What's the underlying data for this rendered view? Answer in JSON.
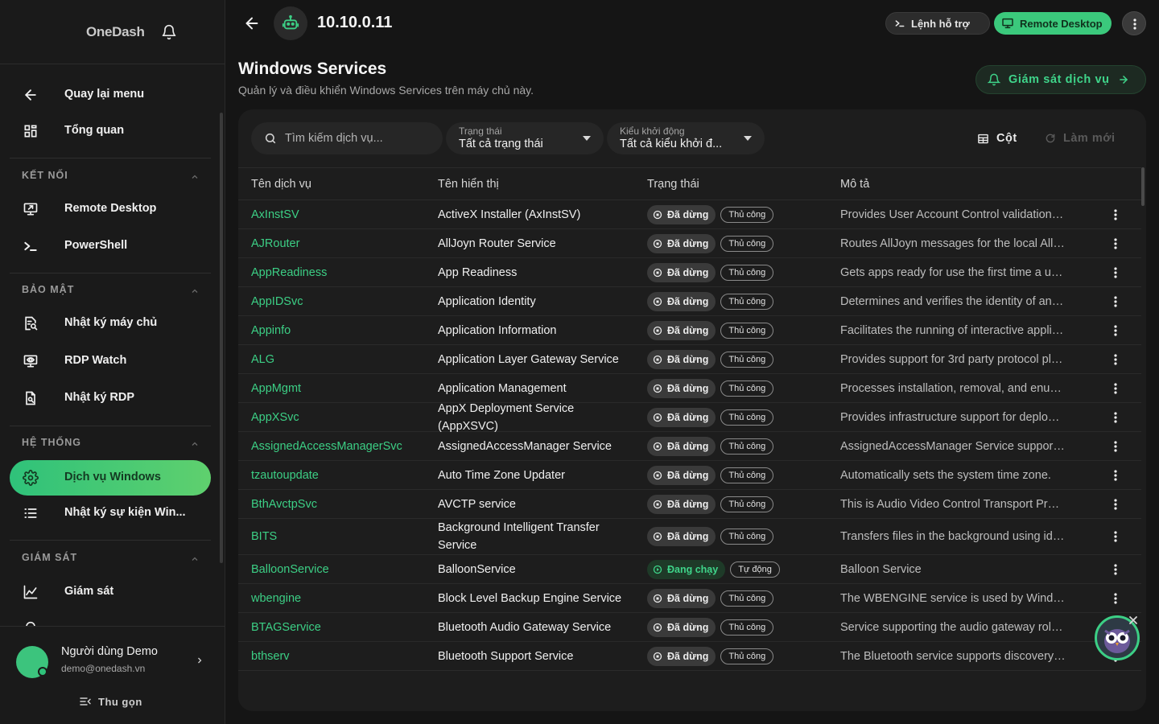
{
  "brand": {
    "name": "OneDash"
  },
  "topbar": {
    "host": "10.10.0.11",
    "help_label": "Lệnh hỗ trợ",
    "rdp_label": "Remote Desktop"
  },
  "sidebar": {
    "back_label": "Quay lại menu",
    "overview_label": "Tổng quan",
    "sections": [
      {
        "title": "KẾT NỐI",
        "items": [
          {
            "label": "Remote Desktop",
            "icon": "remote-desktop-icon"
          },
          {
            "label": "PowerShell",
            "icon": "terminal-icon"
          }
        ]
      },
      {
        "title": "BẢO MẬT",
        "items": [
          {
            "label": "Nhật ký máy chủ",
            "icon": "server-log-icon"
          },
          {
            "label": "RDP Watch",
            "icon": "monitor-eye-icon"
          },
          {
            "label": "Nhật ký RDP",
            "icon": "document-search-icon"
          }
        ]
      },
      {
        "title": "HỆ THỐNG",
        "items": [
          {
            "label": "Dịch vụ Windows",
            "icon": "gear-icon",
            "active": true
          },
          {
            "label": "Nhật ký sự kiện Win...",
            "icon": "list-icon"
          }
        ]
      },
      {
        "title": "GIÁM SÁT",
        "items": [
          {
            "label": "Giám sát",
            "icon": "chart-line-icon"
          }
        ]
      }
    ],
    "user": {
      "name": "Người dùng Demo",
      "email": "demo@onedash.vn"
    },
    "collapse_label": "Thu gọn"
  },
  "page": {
    "title": "Windows Services",
    "subtitle": "Quản lý và điều khiển Windows Services trên máy chủ này.",
    "monitor_label": "Giám sát dịch vụ"
  },
  "toolbar": {
    "search_placeholder": "Tìm kiếm dịch vụ...",
    "status_filter": {
      "label": "Trạng thái",
      "value": "Tất cả trạng thái"
    },
    "startup_filter": {
      "label": "Kiểu khởi động",
      "value": "Tất cả kiểu khởi đ..."
    },
    "columns_label": "Cột",
    "refresh_label": "Làm mới"
  },
  "table": {
    "columns": [
      "Tên dịch vụ",
      "Tên hiển thị",
      "Trạng thái",
      "Mô tả"
    ],
    "rows": [
      {
        "name": "AxInstSV",
        "display": "ActiveX Installer (AxInstSV)",
        "status": "Đã dừng",
        "state": "stopped",
        "startup": "Thủ công",
        "desc": "Provides User Account Control validation…"
      },
      {
        "name": "AJRouter",
        "display": "AllJoyn Router Service",
        "status": "Đã dừng",
        "state": "stopped",
        "startup": "Thủ công",
        "desc": "Routes AllJoyn messages for the local All…"
      },
      {
        "name": "AppReadiness",
        "display": "App Readiness",
        "status": "Đã dừng",
        "state": "stopped",
        "startup": "Thủ công",
        "desc": "Gets apps ready for use the first time a u…"
      },
      {
        "name": "AppIDSvc",
        "display": "Application Identity",
        "status": "Đã dừng",
        "state": "stopped",
        "startup": "Thủ công",
        "desc": "Determines and verifies the identity of an…"
      },
      {
        "name": "Appinfo",
        "display": "Application Information",
        "status": "Đã dừng",
        "state": "stopped",
        "startup": "Thủ công",
        "desc": "Facilitates the running of interactive appli…"
      },
      {
        "name": "ALG",
        "display": "Application Layer Gateway Service",
        "status": "Đã dừng",
        "state": "stopped",
        "startup": "Thủ công",
        "desc": "Provides support for 3rd party protocol pl…"
      },
      {
        "name": "AppMgmt",
        "display": "Application Management",
        "status": "Đã dừng",
        "state": "stopped",
        "startup": "Thủ công",
        "desc": "Processes installation, removal, and enu…"
      },
      {
        "name": "AppXSvc",
        "display": "AppX Deployment Service (AppXSVC)",
        "status": "Đã dừng",
        "state": "stopped",
        "startup": "Thủ công",
        "desc": "Provides infrastructure support for deplo…"
      },
      {
        "name": "AssignedAccessManagerSvc",
        "display": "AssignedAccessManager Service",
        "status": "Đã dừng",
        "state": "stopped",
        "startup": "Thủ công",
        "desc": "AssignedAccessManager Service suppor…"
      },
      {
        "name": "tzautoupdate",
        "display": "Auto Time Zone Updater",
        "status": "Đã dừng",
        "state": "stopped",
        "startup": "Thủ công",
        "desc": "Automatically sets the system time zone."
      },
      {
        "name": "BthAvctpSvc",
        "display": "AVCTP service",
        "status": "Đã dừng",
        "state": "stopped",
        "startup": "Thủ công",
        "desc": "This is Audio Video Control Transport Pr…"
      },
      {
        "name": "BITS",
        "display": "Background Intelligent Transfer Service",
        "status": "Đã dừng",
        "state": "stopped",
        "startup": "Thủ công",
        "desc": "Transfers files in the background using id…"
      },
      {
        "name": "BalloonService",
        "display": "BalloonService",
        "status": "Đang chạy",
        "state": "running",
        "startup": "Tự động",
        "desc": "Balloon Service"
      },
      {
        "name": "wbengine",
        "display": "Block Level Backup Engine Service",
        "status": "Đã dừng",
        "state": "stopped",
        "startup": "Thủ công",
        "desc": "The WBENGINE service is used by Wind…"
      },
      {
        "name": "BTAGService",
        "display": "Bluetooth Audio Gateway Service",
        "status": "Đã dừng",
        "state": "stopped",
        "startup": "Thủ công",
        "desc": "Service supporting the audio gateway rol…"
      },
      {
        "name": "bthserv",
        "display": "Bluetooth Support Service",
        "status": "Đã dừng",
        "state": "stopped",
        "startup": "Thủ công",
        "desc": "The Bluetooth service supports discovery…"
      }
    ]
  },
  "colors": {
    "accent": "#3ccf85",
    "bg": "#151515",
    "card": "#1d1d1d"
  }
}
